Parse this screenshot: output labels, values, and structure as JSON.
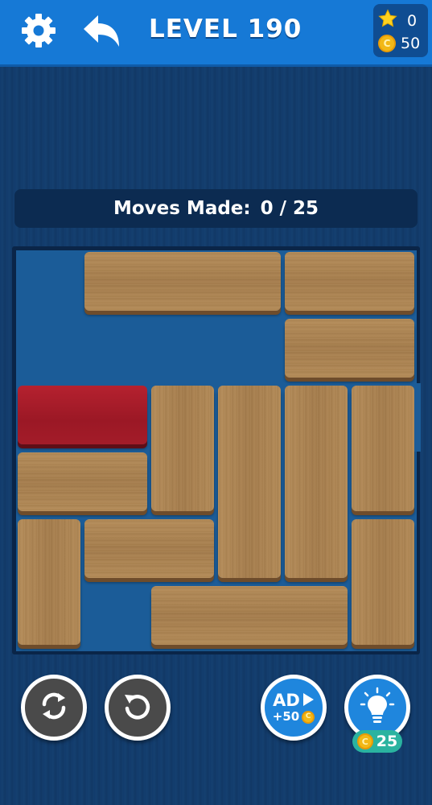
{
  "header": {
    "level_label": "LEVEL 190",
    "stars": "0",
    "coins": "50",
    "icons": [
      "gear-icon",
      "undo-arrow-icon",
      "star-icon",
      "coin-icon"
    ]
  },
  "moves": {
    "label": "Moves Made:",
    "value": "0 / 25",
    "made": 0,
    "limit": 25
  },
  "board": {
    "grid_size": 6,
    "exit_row": 2,
    "blocks": [
      {
        "id": "target",
        "color": "red",
        "row": 2,
        "col": 0,
        "length": 2,
        "orientation": "horizontal"
      },
      {
        "id": "b1",
        "color": "wood",
        "row": 0,
        "col": 1,
        "length": 3,
        "orientation": "horizontal"
      },
      {
        "id": "b2",
        "color": "wood",
        "row": 0,
        "col": 4,
        "length": 2,
        "orientation": "horizontal"
      },
      {
        "id": "b3",
        "color": "wood",
        "row": 1,
        "col": 4,
        "length": 2,
        "orientation": "horizontal"
      },
      {
        "id": "b4",
        "color": "wood",
        "row": 2,
        "col": 2,
        "length": 2,
        "orientation": "vertical"
      },
      {
        "id": "b5",
        "color": "wood",
        "row": 2,
        "col": 3,
        "length": 3,
        "orientation": "vertical"
      },
      {
        "id": "b6",
        "color": "wood",
        "row": 2,
        "col": 4,
        "length": 3,
        "orientation": "vertical"
      },
      {
        "id": "b7",
        "color": "wood",
        "row": 2,
        "col": 5,
        "length": 2,
        "orientation": "vertical"
      },
      {
        "id": "b8",
        "color": "wood",
        "row": 3,
        "col": 0,
        "length": 2,
        "orientation": "horizontal"
      },
      {
        "id": "b9",
        "color": "wood",
        "row": 4,
        "col": 0,
        "length": 2,
        "orientation": "vertical"
      },
      {
        "id": "b10",
        "color": "wood",
        "row": 4,
        "col": 1,
        "length": 2,
        "orientation": "horizontal"
      },
      {
        "id": "b11",
        "color": "wood",
        "row": 4,
        "col": 5,
        "length": 2,
        "orientation": "vertical"
      },
      {
        "id": "b12",
        "color": "wood",
        "row": 5,
        "col": 2,
        "length": 3,
        "orientation": "horizontal"
      }
    ]
  },
  "controls": {
    "ad_label": "AD",
    "ad_reward": "+50",
    "hint_cost": "25",
    "icons": [
      "restart-icon",
      "undo-icon",
      "play-icon",
      "lightbulb-icon"
    ]
  },
  "colors": {
    "topbar": "#1679d6",
    "target_block": "#a31c29",
    "wood": "#a67d4c",
    "board": "#1b5c98"
  }
}
